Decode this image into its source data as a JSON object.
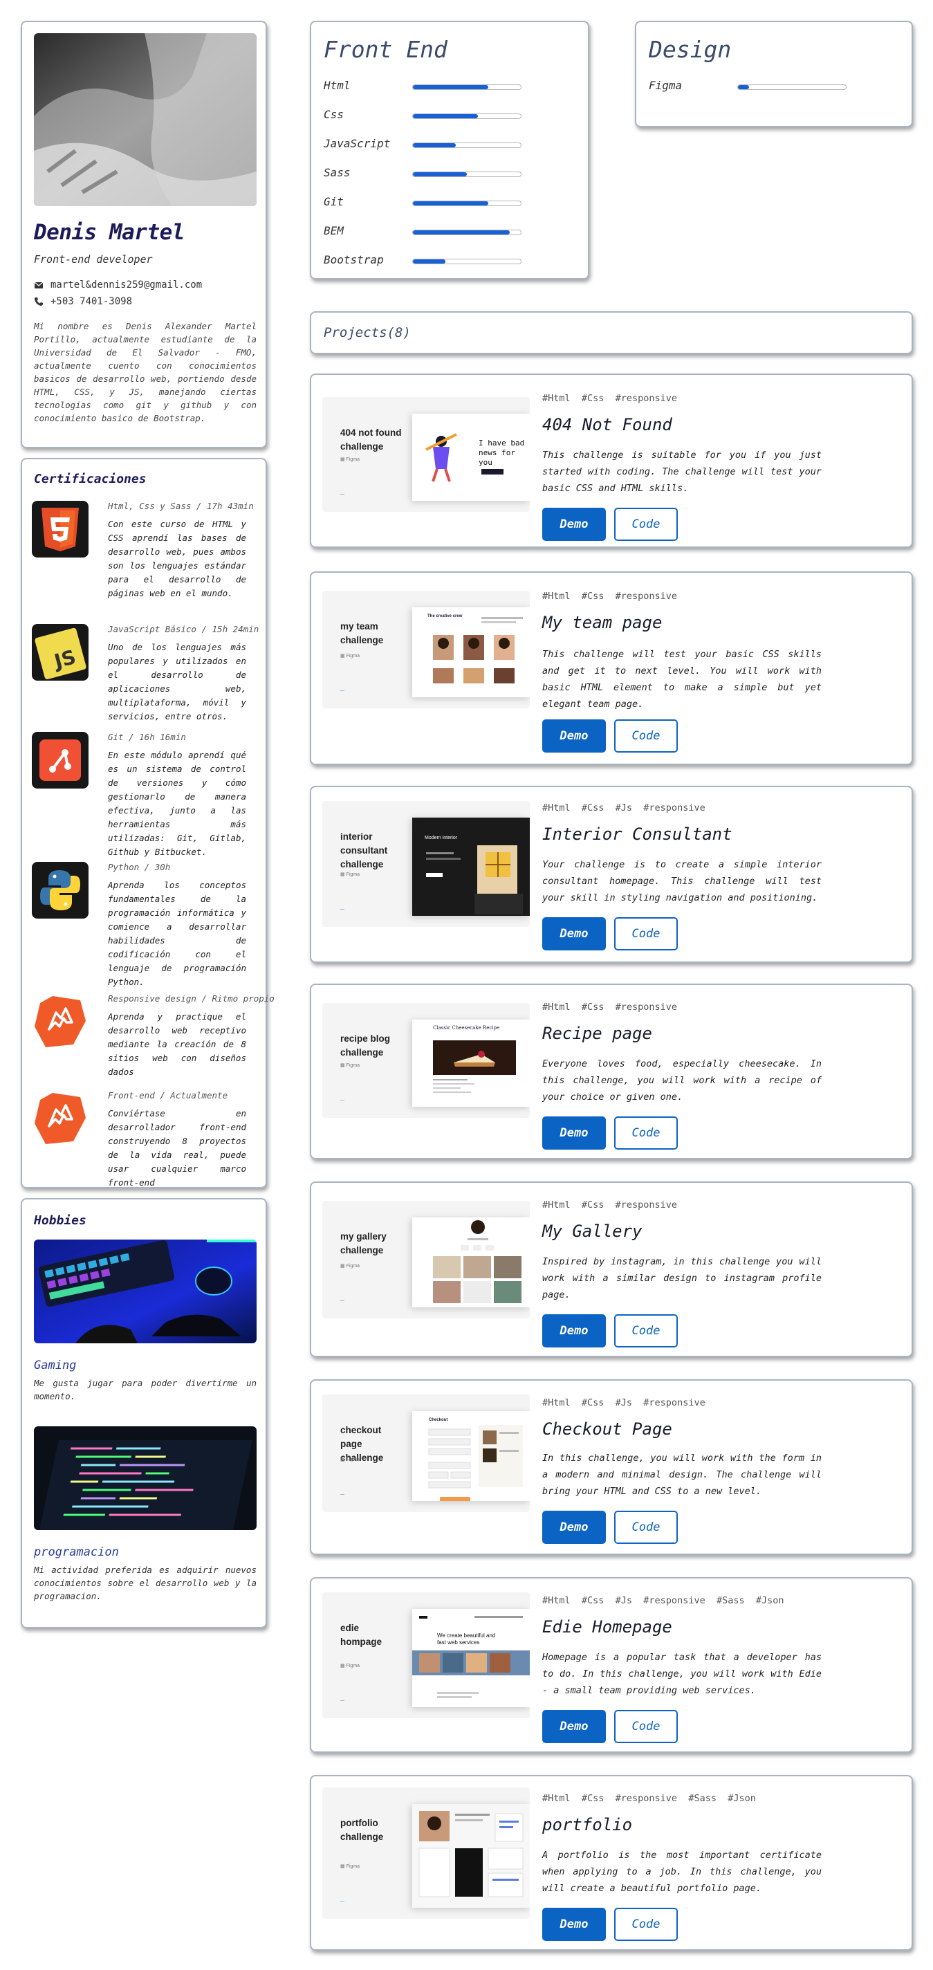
{
  "profile": {
    "name": "Denis Martel",
    "role": "Front-end developer",
    "email": "martel&dennis259@gmail.com",
    "phone": "+503 7401-3098",
    "bio": "Mi nombre es Denis Alexander Martel Portillo, actualmente estudiante de la Universidad de El Salvador - FMO, actualmente cuento con conocimientos basicos de desarrollo web, portiendo desde HTML, CSS, y JS, manejando ciertas tecnologias como git y github y con conocimiento basico de Bootstrap."
  },
  "certificaciones": {
    "title": "Certificaciones",
    "items": [
      {
        "icon": "html5-icon",
        "head": "Html, Css y Sass / 17h 43min",
        "text": "Con este curso de HTML y CSS aprendí las bases de desarrollo web, pues ambos son los lenguajes estándar para el desarrollo de páginas web en el mundo."
      },
      {
        "icon": "js-icon",
        "head": "JavaScript Básico / 15h 24min",
        "text": "Uno de los lenguajes más populares y utilizados en el desarrollo de aplicaciones web, multiplataforma, móvil y servicios, entre otros."
      },
      {
        "icon": "git-icon",
        "head": "Git / 16h 16min",
        "text": "En este módulo aprendí qué es un sistema de control de versiones y cómo gestionarlo de manera efectiva, junto a las herramientas más utilizadas: Git, Gitlab, Github y Bitbucket."
      },
      {
        "icon": "python-icon",
        "head": "Python / 30h",
        "text": "Aprenda los conceptos fundamentales de la programación informática y comience a desarrollar habilidades de codificación con el lenguaje de programación Python."
      },
      {
        "icon": "freecodecamp-icon",
        "head": "Responsive design / Ritmo propio",
        "text": "Aprenda y practique el desarrollo web receptivo mediante la creación de 8 sitios web con diseños dados"
      },
      {
        "icon": "freecodecamp-icon",
        "head": "Front-end / Actualmente",
        "text": "Conviértase en desarrollador front-end construyendo 8 proyectos de la vida real, puede usar cualquier marco front-end"
      }
    ]
  },
  "hobbies": {
    "title": "Hobbies",
    "items": [
      {
        "title": "Gaming",
        "text": "Me gusta jugar para poder divertirme un momento."
      },
      {
        "title": "programacion",
        "text": "Mi actividad preferida es adquirir nuevos conocimientos sobre el desarrollo web y la programacion."
      }
    ]
  },
  "skills": {
    "frontend": {
      "title": "Front End",
      "items": [
        {
          "name": "Html",
          "level": 0.7
        },
        {
          "name": "Css",
          "level": 0.6
        },
        {
          "name": "JavaScript",
          "level": 0.4
        },
        {
          "name": "Sass",
          "level": 0.5
        },
        {
          "name": "Git",
          "level": 0.7
        },
        {
          "name": "BEM",
          "level": 0.9
        },
        {
          "name": "Bootstrap",
          "level": 0.3
        }
      ]
    },
    "design": {
      "title": "Design",
      "items": [
        {
          "name": "Figma",
          "level": 0.1
        }
      ]
    }
  },
  "projects_header": "Projects(8)",
  "buttons": {
    "demo": "Demo",
    "code": "Code"
  },
  "projects": [
    {
      "thumb_label": "404 not found challenge",
      "tags": "#Html  #Css  #responsive",
      "title": "404 Not Found",
      "description": "This challenge is suitable for you if you just started with coding. The challenge will test your basic CSS and HTML skills.",
      "shot": "404",
      "shot_text": "I have bad news for you"
    },
    {
      "thumb_label": "my team challenge",
      "tags": "#Html  #Css  #responsive",
      "title": "My team page",
      "description": "This challenge will test your basic CSS skills and get it to next level. You will work with basic HTML element to make a simple but yet elegant team page.",
      "shot": "team",
      "shot_text": "The creative crew"
    },
    {
      "thumb_label": "interior consultant challenge",
      "tags": "#Html  #Css  #Js  #responsive",
      "title": "Interior Consultant",
      "description": "Your challenge is to create a simple interior consultant homepage. This challenge will test your skill in styling navigation and positioning.",
      "shot": "interior",
      "shot_text": "Modern interior"
    },
    {
      "thumb_label": "recipe blog challenge",
      "tags": "#Html  #Css  #responsive",
      "title": "Recipe page",
      "description": "Everyone loves food, especially cheesecake. In this challenge, you will work with a recipe of your choice or given one.",
      "shot": "recipe",
      "shot_text": "Classic Cheesecake Recipe"
    },
    {
      "thumb_label": "my gallery challenge",
      "tags": "#Html  #Css  #responsive",
      "title": "My Gallery",
      "description": "Inspired by instagram, in this challenge you will work with a similar design to instagram profile page.",
      "shot": "gallery",
      "shot_text": ""
    },
    {
      "thumb_label": "checkout page challenge",
      "tags": "#Html  #Css  #Js  #responsive",
      "title": "Checkout Page",
      "description": "In this challenge, you will work with the form in a modern and minimal design. The challenge will bring your HTML and CSS to a new level.",
      "shot": "checkout",
      "shot_text": "Checkout"
    },
    {
      "thumb_label": "edie hompage",
      "tags": "#Html  #Css  #Js  #responsive  #Sass  #Json",
      "title": "Edie Homepage",
      "description": "Homepage is a popular task that a developer has to do. In this challenge, you will work with Edie - a small team providing web services.",
      "shot": "edie",
      "shot_text": "We create beautiful and fast web services"
    },
    {
      "thumb_label": "portfolio challenge",
      "tags": "#Html  #Css  #responsive  #Sass  #Json",
      "title": "portfolio",
      "description": "A portfolio is the most important certificate when applying to a job. In this challenge, you will create a beautiful portfolio page.",
      "shot": "portfolio",
      "shot_text": ""
    }
  ]
}
